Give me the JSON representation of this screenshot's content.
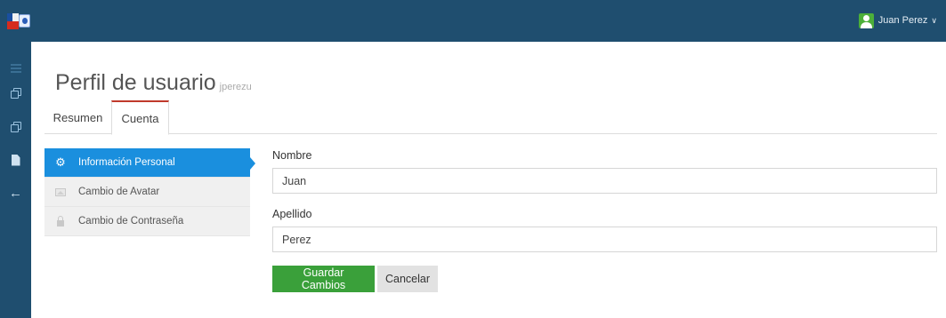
{
  "header": {
    "user_name": "Juan Perez",
    "user_chevron": "∨"
  },
  "rail": {
    "icons": [
      "menu-icon",
      "copy-icon",
      "copy-icon",
      "document-icon",
      "arrow-left-icon"
    ]
  },
  "page": {
    "title": "Perfil de usuario",
    "subtitle": "jperezu"
  },
  "tabs": [
    {
      "label": "Resumen",
      "active": false
    },
    {
      "label": "Cuenta",
      "active": true
    }
  ],
  "side_menu": [
    {
      "label": "Información Personal",
      "icon": "gear-icon",
      "active": true
    },
    {
      "label": "Cambio de Avatar",
      "icon": "image-icon",
      "active": false
    },
    {
      "label": "Cambio de Contraseña",
      "icon": "lock-icon",
      "active": false
    }
  ],
  "form": {
    "nombre_label": "Nombre",
    "nombre_value": "Juan",
    "apellido_label": "Apellido",
    "apellido_value": "Perez",
    "save_label": "Guardar Cambios",
    "cancel_label": "Cancelar"
  },
  "colors": {
    "topbar": "#1f4e6f",
    "active_item": "#1a8fde",
    "save_button": "#3aa03a",
    "tab_accent": "#c0392b"
  }
}
